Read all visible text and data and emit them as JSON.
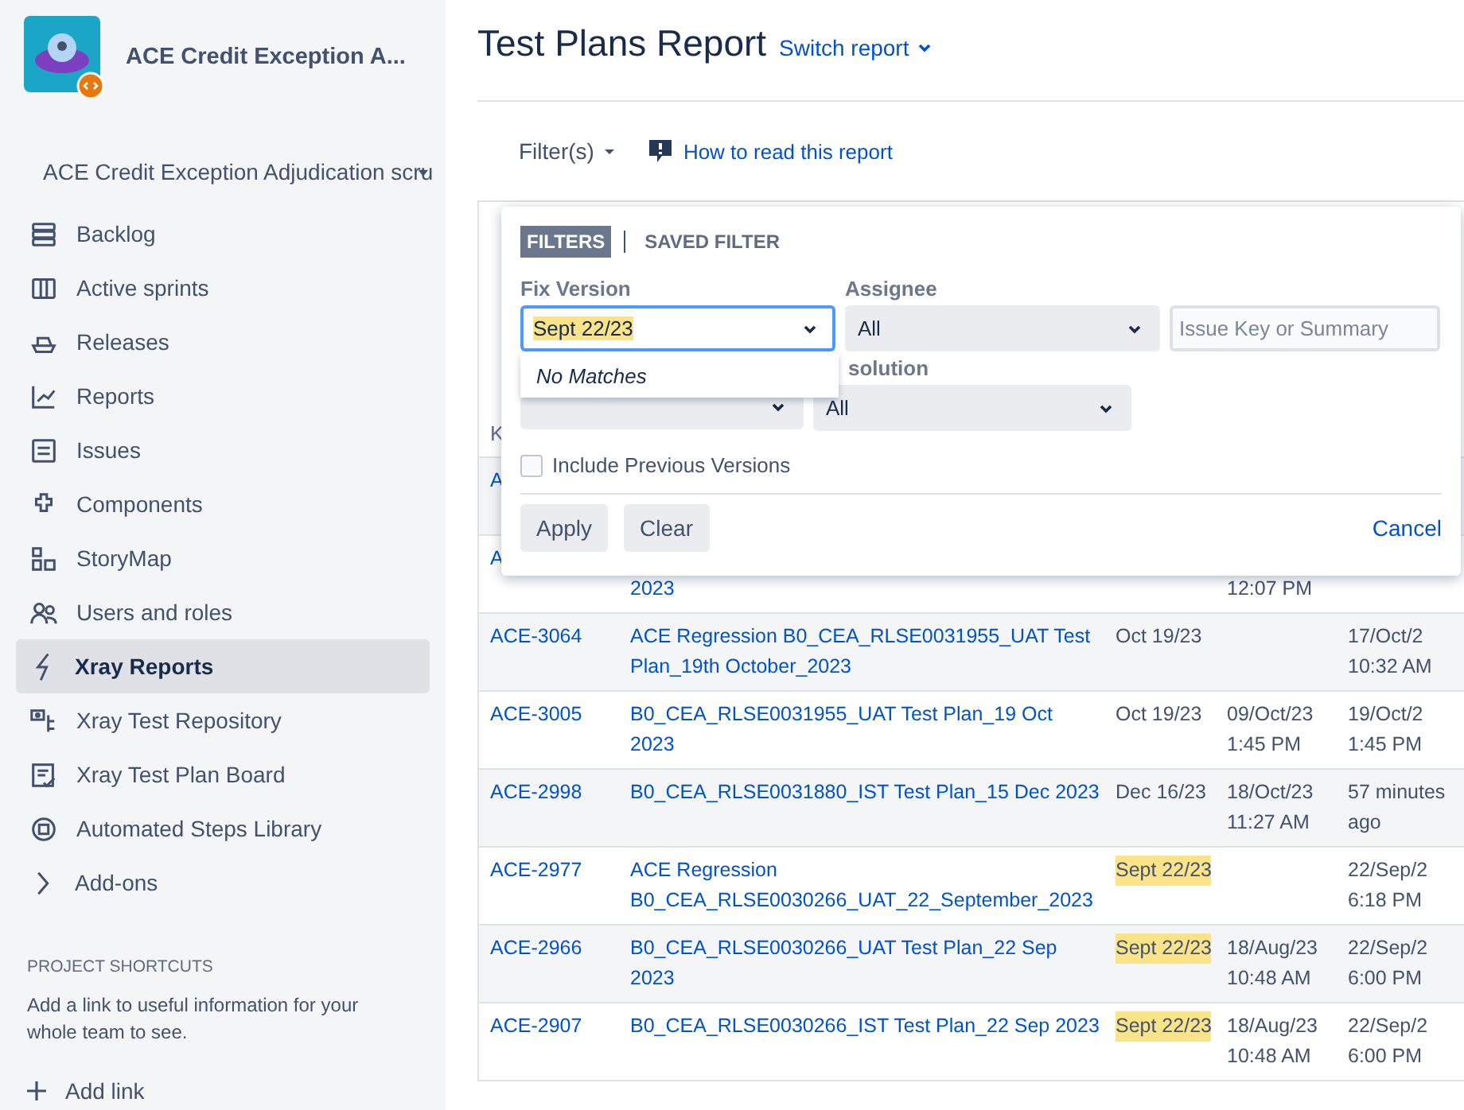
{
  "sidebar": {
    "project_name": "ACE Credit Exception A...",
    "board_selector": "ACE Credit Exception Adjudication scru",
    "items": [
      {
        "label": "Backlog",
        "selected": false
      },
      {
        "label": "Active sprints",
        "selected": false
      },
      {
        "label": "Releases",
        "selected": false
      },
      {
        "label": "Reports",
        "selected": false
      },
      {
        "label": "Issues",
        "selected": false
      },
      {
        "label": "Components",
        "selected": false
      },
      {
        "label": "StoryMap",
        "selected": false
      },
      {
        "label": "Users and roles",
        "selected": false
      },
      {
        "label": "Xray Reports",
        "selected": true
      },
      {
        "label": "Xray Test Repository",
        "selected": false
      },
      {
        "label": "Xray Test Plan Board",
        "selected": false
      },
      {
        "label": "Automated Steps Library",
        "selected": false
      },
      {
        "label": "Add-ons",
        "selected": false
      }
    ],
    "shortcuts_heading": "PROJECT SHORTCUTS",
    "shortcuts_text": "Add a link to useful information for your whole team to see.",
    "add_link": "Add link"
  },
  "header": {
    "title": "Test Plans Report",
    "switch_report": "Switch report"
  },
  "toolbar": {
    "filters_button": "Filter(s)",
    "help_link": "How to read this report"
  },
  "table": {
    "header_fragment": "K",
    "covered_rows": [
      {
        "column_1": "A"
      },
      {
        "column_1": "A",
        "column_2": "2023",
        "column_4": "12:07 PM"
      }
    ],
    "rows": [
      {
        "column_1": "ACE-3064",
        "column_2": "ACE Regression B0_CEA_RLSE0031955_UAT Test Plan_19th October_2023",
        "column_3": "Oct 19/23",
        "highlighted": false,
        "column_4": "",
        "column_5": "17/Oct/2 10:32 AM"
      },
      {
        "column_1": "ACE-3005",
        "column_2": "B0_CEA_RLSE0031955_UAT Test Plan_19 Oct 2023",
        "column_3": "Oct 19/23",
        "highlighted": false,
        "column_4": "09/Oct/23 1:45 PM",
        "column_5": "19/Oct/2 1:45 PM"
      },
      {
        "column_1": "ACE-2998",
        "column_2": "B0_CEA_RLSE0031880_IST Test Plan_15 Dec 2023",
        "column_3": "Dec 16/23",
        "highlighted": false,
        "column_4": "18/Oct/23 11:27 AM",
        "column_5": "57 minutes ago"
      },
      {
        "column_1": "ACE-2977",
        "column_2": "ACE Regression B0_CEA_RLSE0030266_UAT_22_September_2023",
        "column_3": "Sept 22/23",
        "highlighted": true,
        "column_4": "",
        "column_5": "22/Sep/2 6:18 PM"
      },
      {
        "column_1": "ACE-2966",
        "column_2": "B0_CEA_RLSE0030266_UAT Test Plan_22 Sep 2023",
        "column_3": "Sept 22/23",
        "highlighted": true,
        "column_4": "18/Aug/23 10:48 AM",
        "column_5": "22/Sep/2 6:00 PM"
      },
      {
        "column_1": "ACE-2907",
        "column_2": "B0_CEA_RLSE0030266_IST Test Plan_22 Sep 2023",
        "column_3": "Sept 22/23",
        "highlighted": true,
        "column_4": "18/Aug/23 10:48 AM",
        "column_5": "22/Sep/2 6:00 PM"
      }
    ]
  },
  "filter_panel": {
    "tabs": [
      {
        "label": "FILTERS",
        "selected": true
      },
      {
        "label": "SAVED FILTER",
        "selected": false
      }
    ],
    "fix_version": {
      "label": "Fix Version",
      "value": "Sept 22/23",
      "highlighted": true
    },
    "assignee": {
      "label": "Assignee",
      "value": "All"
    },
    "search": {
      "placeholder": "Issue Key or Summary"
    },
    "suggestions": {
      "message": "No Matches"
    },
    "resolution": {
      "label": "solution",
      "value": "All"
    },
    "include_previous": {
      "label": "Include Previous Versions",
      "checked": false
    },
    "buttons": [
      {
        "label": "Apply"
      },
      {
        "label": "Clear"
      }
    ],
    "cancel": "Cancel"
  }
}
